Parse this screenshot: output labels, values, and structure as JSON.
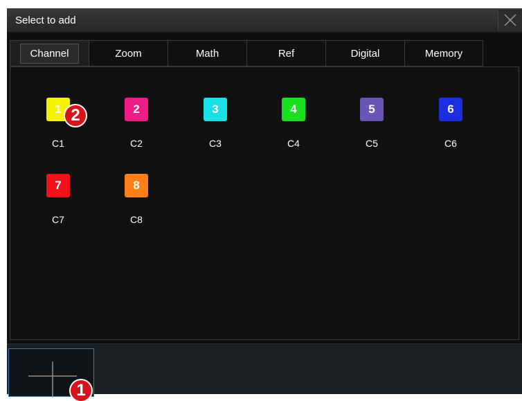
{
  "dialog": {
    "title": "Select to add"
  },
  "tabs": [
    {
      "label": "Channel",
      "active": true
    },
    {
      "label": "Zoom"
    },
    {
      "label": "Math"
    },
    {
      "label": "Ref"
    },
    {
      "label": "Digital"
    },
    {
      "label": "Memory"
    }
  ],
  "channels": [
    {
      "number": "1",
      "label": "C1",
      "color": "#f7f200"
    },
    {
      "number": "2",
      "label": "C2",
      "color": "#f01d86"
    },
    {
      "number": "3",
      "label": "C3",
      "color": "#19e0e6"
    },
    {
      "number": "4",
      "label": "C4",
      "color": "#19e11d"
    },
    {
      "number": "5",
      "label": "C5",
      "color": "#6a55b7"
    },
    {
      "number": "6",
      "label": "C6",
      "color": "#1c2fe0"
    },
    {
      "number": "7",
      "label": "C7",
      "color": "#f1121b"
    },
    {
      "number": "8",
      "label": "C8",
      "color": "#ff7f19"
    }
  ],
  "callouts": {
    "one": "1",
    "two": "2"
  },
  "icons": {
    "close": "close-icon",
    "add": "plus-icon"
  }
}
